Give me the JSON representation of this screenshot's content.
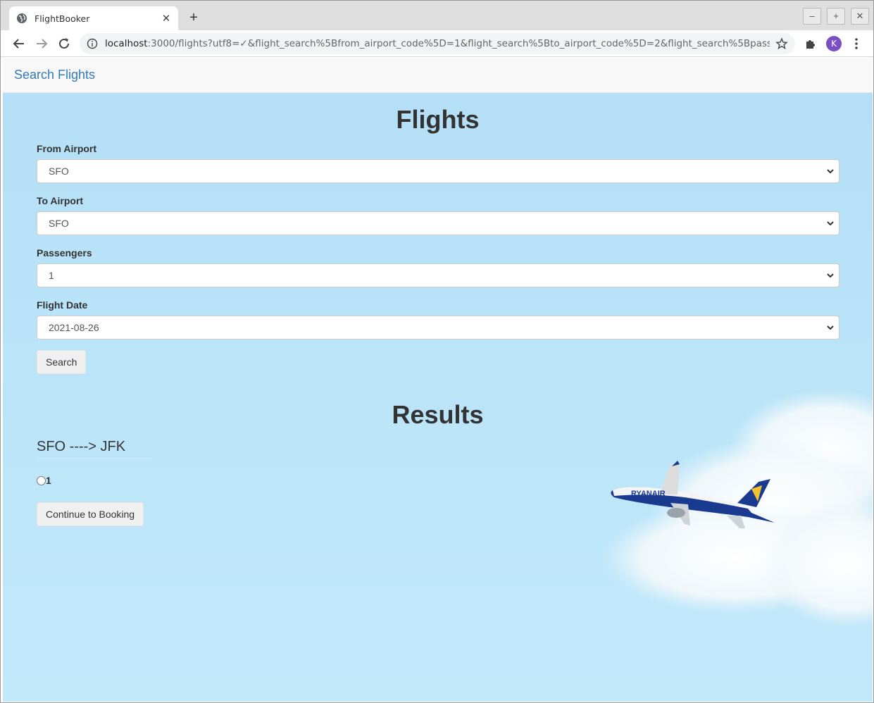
{
  "browser": {
    "tab_title": "FlightBooker",
    "url_host": "localhost",
    "url_rest": ":3000/flights?utf8=✓&flight_search%5Bfrom_airport_code%5D=1&flight_search%5Bto_airport_code%5D=2&flight_search%5Bpasse...",
    "avatar_letter": "K",
    "accent_color": "#7b4fc4"
  },
  "navbar": {
    "brand": "Search Flights",
    "brand_color": "#337ab7"
  },
  "search": {
    "heading": "Flights",
    "from_label": "From Airport",
    "from_value": "SFO",
    "to_label": "To Airport",
    "to_value": "SFO",
    "passengers_label": "Passengers",
    "passengers_value": "1",
    "date_label": "Flight Date",
    "date_value": "2021-08-26",
    "search_button": "Search"
  },
  "results": {
    "heading": "Results",
    "route": "SFO ----> JFK",
    "flight_option_label": "1",
    "continue_button": "Continue to Booking"
  },
  "icons": [
    "globe-icon",
    "close-icon",
    "plus-icon",
    "minimize-icon",
    "maximize-icon",
    "window-close-icon",
    "back-arrow-icon",
    "forward-arrow-icon",
    "reload-icon",
    "info-icon",
    "star-icon",
    "puzzle-icon",
    "kebab-menu-icon",
    "chevron-down-icon"
  ],
  "background_image": "sky-with-airplane"
}
